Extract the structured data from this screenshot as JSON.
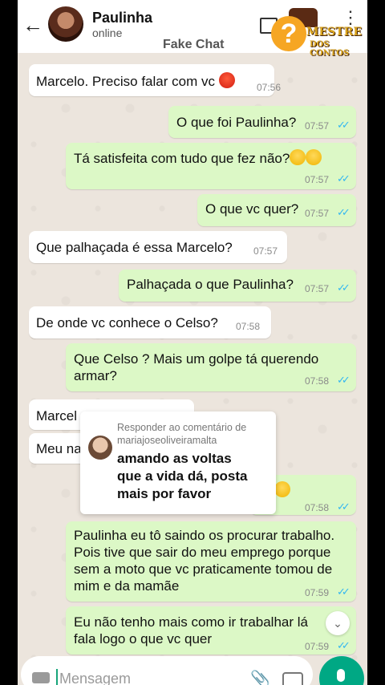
{
  "header": {
    "contact_name": "Paulinha",
    "status": "online",
    "watermark": "Fake Chat",
    "logo_line1": "MESTRE",
    "logo_line2": "DOS CONTOS"
  },
  "messages": [
    {
      "dir": "in",
      "text": "Marcelo. Preciso falar com vc",
      "time": "07:56"
    },
    {
      "dir": "out",
      "text": "O que foi Paulinha?",
      "time": "07:57"
    },
    {
      "dir": "out",
      "text": "Tá satisfeita com tudo que fez não?",
      "time": "07:57"
    },
    {
      "dir": "out",
      "text": "O que vc quer?",
      "time": "07:57"
    },
    {
      "dir": "in",
      "text": "Que palhaçada é essa Marcelo?",
      "time": "07:57"
    },
    {
      "dir": "out",
      "text": "Palhaçada o que Paulinha?",
      "time": "07:57"
    },
    {
      "dir": "in",
      "text": "De onde vc conhece o Celso?",
      "time": "07:58"
    },
    {
      "dir": "out",
      "text": "Que Celso ? Mais um golpe tá querendo\narmar?",
      "time": "07:58"
    },
    {
      "dir": "in",
      "text": "Marcel",
      "time": ""
    },
    {
      "dir": "in",
      "text": "Meu na",
      "time": ""
    },
    {
      "dir": "out",
      "text": "",
      "time": "07:58"
    },
    {
      "dir": "out",
      "text": "Paulinha eu tô saindo os procurar trabalho.\nPois tive que sair do meu emprego porque\nsem a moto que vc praticamente tomou de\nmim e da mamãe",
      "time": "07:59"
    },
    {
      "dir": "out",
      "text": "Eu não tenho mais como ir trabalhar lá\nfala logo o que vc quer",
      "time": "07:59"
    }
  ],
  "comment_popup": {
    "header_prefix": "Responder ao comentário de",
    "username": "mariajoseoliveiramalta",
    "body": "amando as voltas\nque a vida dá, posta\nmais por favor"
  },
  "composer": {
    "placeholder": "Mensagem"
  },
  "icons": {
    "back": "arrow-left-icon",
    "more": "more-vertical-icon",
    "attach": "paperclip-icon",
    "camera": "camera-icon",
    "mic": "microphone-icon",
    "scroll": "chevron-double-down-icon"
  },
  "colors": {
    "incoming": "#ffffff",
    "outgoing": "#dcf8c6",
    "accent": "#00a884",
    "read_tick": "#34b7f1"
  }
}
